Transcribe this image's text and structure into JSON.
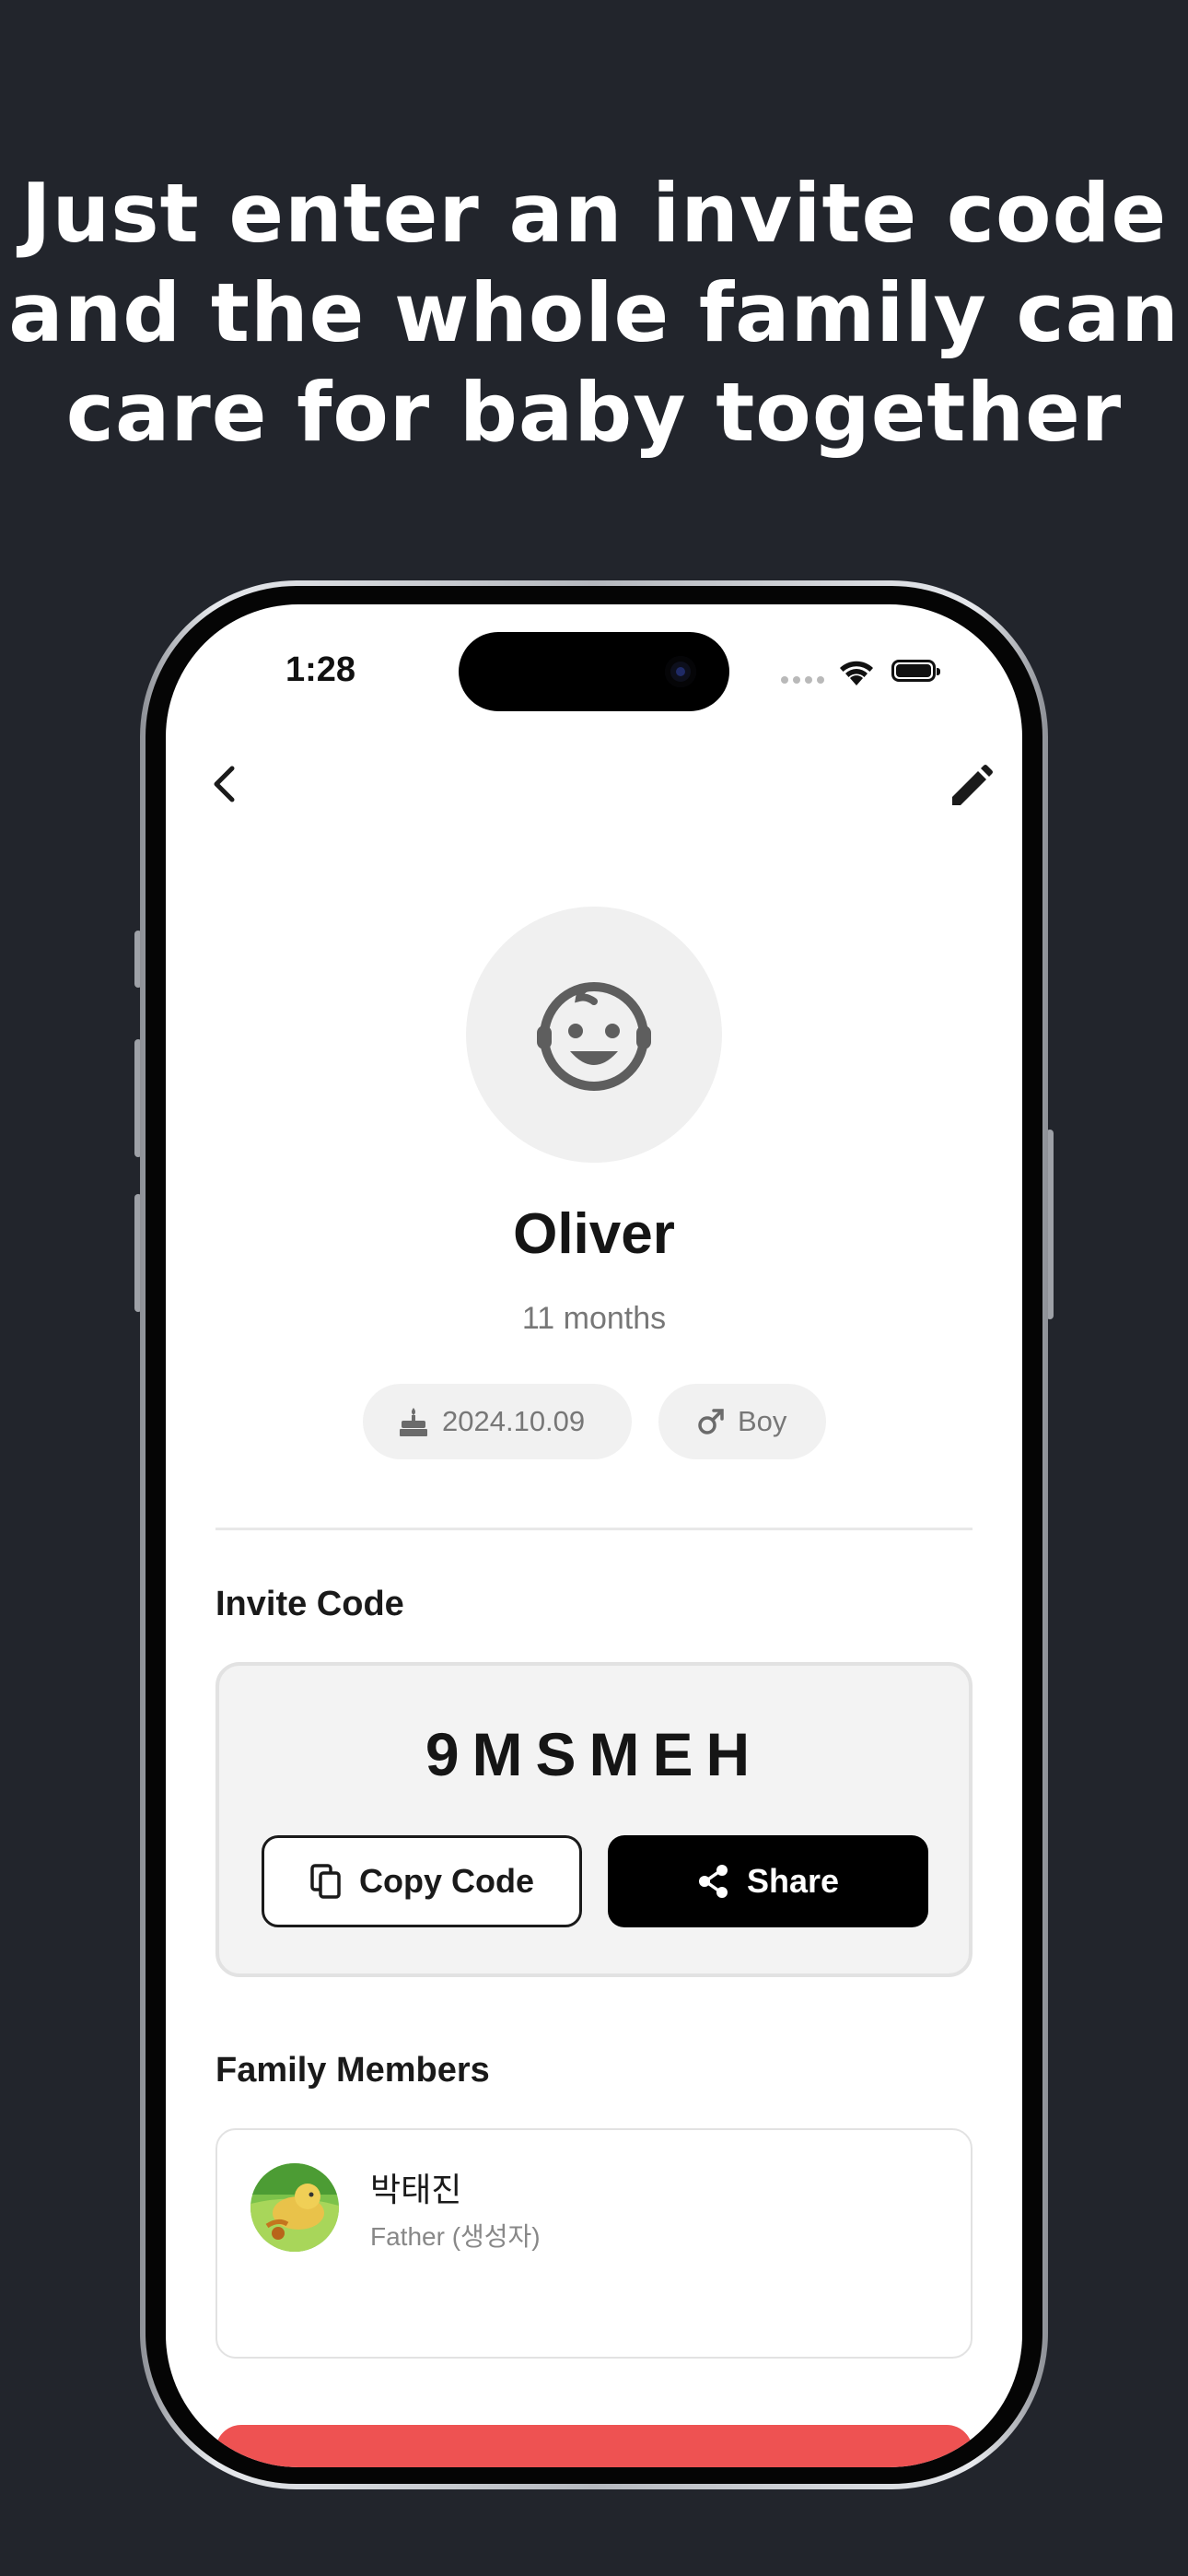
{
  "headline": {
    "line1": "Just enter an invite code",
    "line2": "and the whole family can",
    "line3": "care for baby together"
  },
  "status_bar": {
    "time": "1:28",
    "icons": [
      "signal-dots-icon",
      "wifi-icon",
      "battery-icon"
    ]
  },
  "nav": {
    "back_icon": "chevron-left-icon",
    "edit_icon": "pencil-icon"
  },
  "profile": {
    "avatar_icon": "baby-face-icon",
    "name": "Oliver",
    "age": "11 months",
    "birth_date": "2024.10.09",
    "birth_icon": "cake-icon",
    "gender": "Boy",
    "gender_icon": "male-symbol-icon"
  },
  "invite": {
    "title": "Invite Code",
    "code": "9MSMEH",
    "copy_label": "Copy Code",
    "share_label": "Share"
  },
  "family": {
    "title": "Family Members",
    "members": [
      {
        "name": "박태진",
        "role": "Father (생성자)"
      }
    ]
  },
  "colors": {
    "background": "#22252c",
    "screen": "#ffffff",
    "accent_red": "#ee5252",
    "share_button": "#000000"
  }
}
